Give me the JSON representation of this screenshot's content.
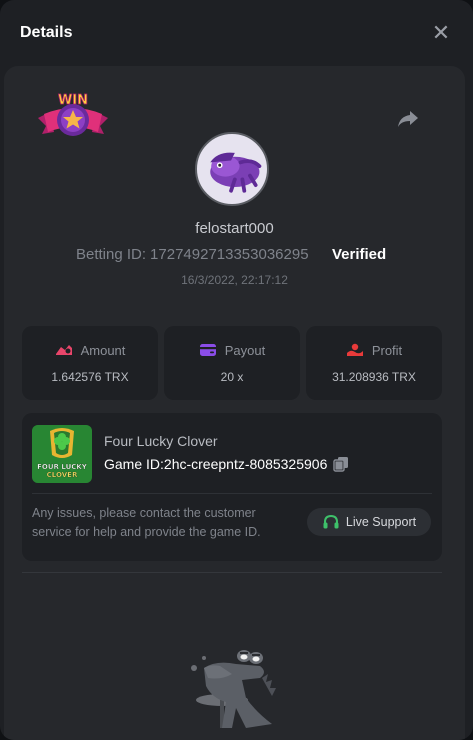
{
  "header": {
    "title": "Details",
    "close_icon": "close-icon"
  },
  "badge": {
    "text": "WIN"
  },
  "user": {
    "username": "felostart000",
    "betting_id_label": "Betting ID:",
    "betting_id": "1727492713353036295",
    "verified_label": "Verified",
    "datetime": "16/3/2022, 22:17:12"
  },
  "stats": {
    "amount": {
      "label": "Amount",
      "value": "1.642576 TRX",
      "icon": "amount-icon",
      "color": "#e8456a"
    },
    "payout": {
      "label": "Payout",
      "value": "20 x",
      "icon": "wallet-icon",
      "color": "#8b4de8"
    },
    "profit": {
      "label": "Profit",
      "value": "31.208936 TRX",
      "icon": "profit-icon",
      "color": "#e83a3a"
    }
  },
  "game": {
    "name": "Four Lucky Clover",
    "id_label": "Game ID:",
    "id_value": "2hc-creepntz-8085325906",
    "thumb_text": "FOUR LUCKY CLOVER",
    "help_text": "Any issues, please contact the customer service for help and provide the game ID.",
    "support_label": "Live Support",
    "support_color": "#3ec06a"
  }
}
